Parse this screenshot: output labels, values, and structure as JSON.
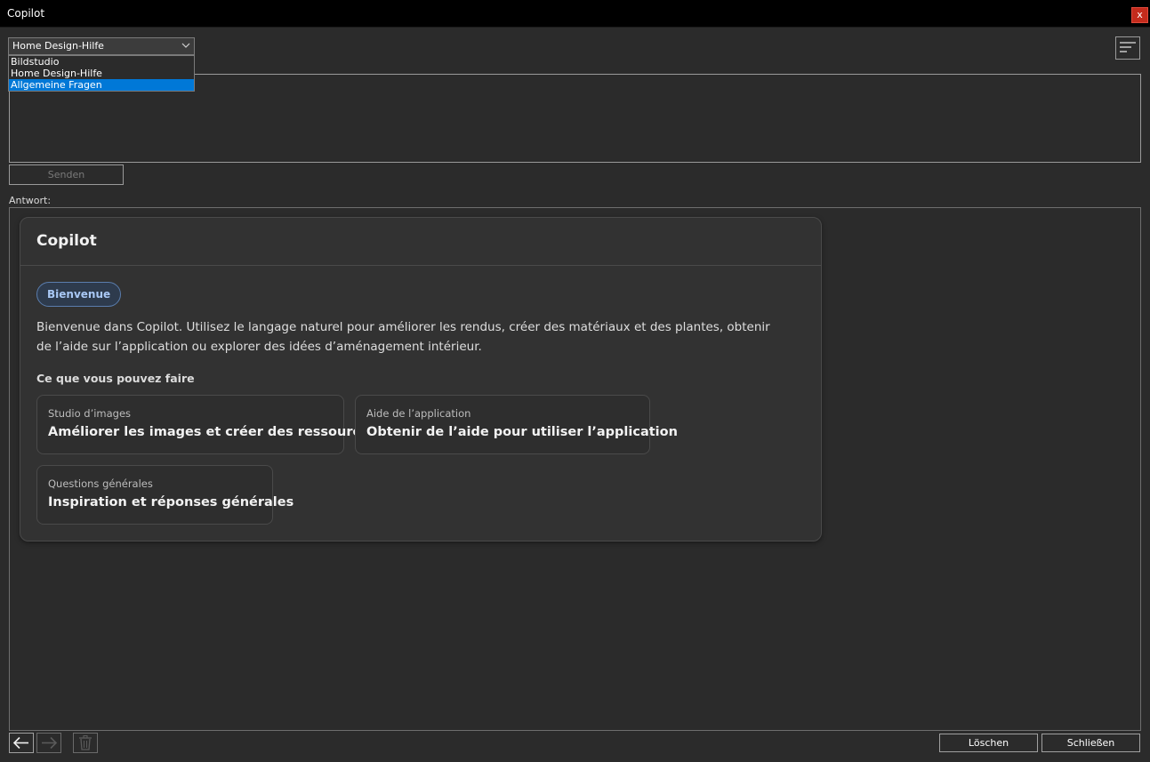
{
  "window": {
    "title": "Copilot",
    "close_label": "x"
  },
  "mode_select": {
    "selected": "Home Design-Hilfe",
    "options": [
      "Bildstudio",
      "Home Design-Hilfe",
      "Allgemeine Fragen"
    ]
  },
  "input": {
    "send_label": "Senden"
  },
  "answer": {
    "label": "Antwort:",
    "card": {
      "title": "Copilot",
      "badge": "Bienvenue",
      "intro": "Bienvenue dans Copilot. Utilisez le langage naturel pour améliorer les rendus, créer des matériaux et des plantes, obtenir de l’aide sur l’application ou explorer des idées d’aménagement intérieur.",
      "subheading": "Ce que vous pouvez faire",
      "tiles": [
        {
          "small": "Studio d’images",
          "big": "Améliorer les images et créer des ressources"
        },
        {
          "small": "Aide de l’application",
          "big": "Obtenir de l’aide pour utiliser l’application"
        },
        {
          "small": "Questions générales",
          "big": "Inspiration et réponses générales"
        }
      ]
    }
  },
  "footer": {
    "delete_label": "Löschen",
    "close_label": "Schließen"
  },
  "colors": {
    "accent": "#0078d7",
    "close": "#c42b1c",
    "badge_text": "#a9c8f5"
  }
}
